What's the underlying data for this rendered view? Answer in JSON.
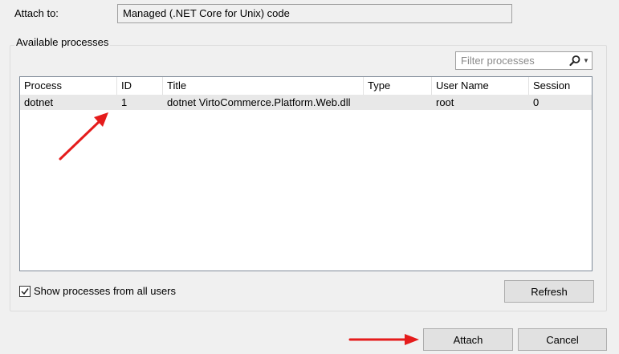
{
  "attach": {
    "label": "Attach to:",
    "value": "Managed (.NET Core for Unix) code"
  },
  "group": {
    "label": "Available processes",
    "filter_placeholder": "Filter processes",
    "search_icon": "search-icon",
    "dropdown_icon": "chevron-down-icon"
  },
  "table": {
    "columns": [
      "Process",
      "ID",
      "Title",
      "Type",
      "User Name",
      "Session"
    ],
    "rows": [
      {
        "process": "dotnet",
        "id": "1",
        "title": "dotnet VirtoCommerce.Platform.Web.dll",
        "type": "",
        "user": "root",
        "session": "0"
      }
    ],
    "selected_row_color": "#e8e8e8"
  },
  "options": {
    "show_all_users_label": "Show processes from all users",
    "show_all_users_checked": true
  },
  "buttons": {
    "refresh": "Refresh",
    "attach": "Attach",
    "cancel": "Cancel"
  },
  "annotations": {
    "arrow_color": "#e51c1c"
  }
}
